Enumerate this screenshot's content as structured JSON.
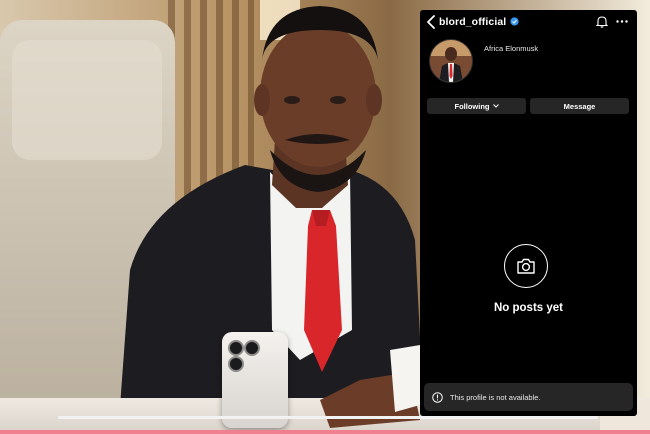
{
  "profile": {
    "username": "blord_official",
    "display_name": "Africa Elonmusk",
    "verified": true
  },
  "actions": {
    "following_label": "Following",
    "message_label": "Message"
  },
  "posts": {
    "empty_label": "No posts yet"
  },
  "notice": {
    "text": "This profile is not available."
  },
  "colors": {
    "overlay_bg": "#000000",
    "button_bg": "#262626",
    "verified": "#3897f0",
    "tie": "#d8262b"
  },
  "icons": [
    "back-arrow-icon",
    "verified-badge-icon",
    "bell-icon",
    "more-icon",
    "chevron-down-icon",
    "camera-icon",
    "info-icon"
  ]
}
